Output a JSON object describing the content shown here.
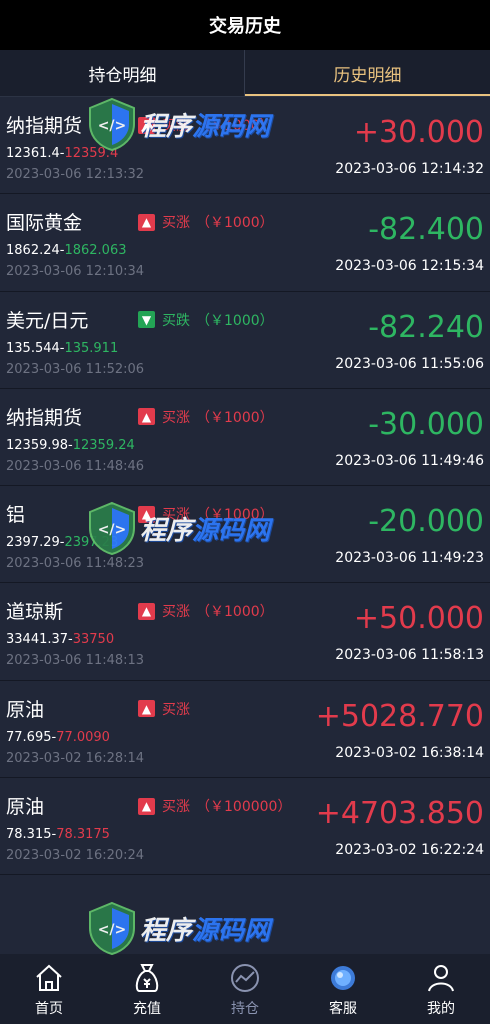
{
  "header": {
    "title": "交易历史"
  },
  "tabs": [
    {
      "label": "持仓明细",
      "active": false
    },
    {
      "label": "历史明细",
      "active": true
    }
  ],
  "colors": {
    "up": "#e23b4c",
    "down": "#2eb662",
    "accent": "#e9c27f",
    "background": "#212738"
  },
  "trades": [
    {
      "name": "纳指期货",
      "direction": "up",
      "label": "买涨",
      "amount": "（￥1000）",
      "open_price": "12361.4-",
      "close_price": "12359.4",
      "close_color": "red",
      "open_time": "2023-03-06 12:13:32",
      "pnl": "+30.000",
      "pnl_color": "red",
      "close_time": "2023-03-06 12:14:32"
    },
    {
      "name": "国际黄金",
      "direction": "up",
      "label": "买涨",
      "amount": "（￥1000）",
      "open_price": "1862.24-",
      "close_price": "1862.063",
      "close_color": "green",
      "open_time": "2023-03-06 12:10:34",
      "pnl": "-82.400",
      "pnl_color": "green",
      "close_time": "2023-03-06 12:15:34"
    },
    {
      "name": "美元/日元",
      "direction": "down",
      "label": "买跌",
      "amount": "（￥1000）",
      "open_price": "135.544-",
      "close_price": "135.911",
      "close_color": "green",
      "open_time": "2023-03-06 11:52:06",
      "pnl": "-82.240",
      "pnl_color": "green",
      "close_time": "2023-03-06 11:55:06"
    },
    {
      "name": "纳指期货",
      "direction": "up",
      "label": "买涨",
      "amount": "（￥1000）",
      "open_price": "12359.98-",
      "close_price": "12359.24",
      "close_color": "green",
      "open_time": "2023-03-06 11:48:46",
      "pnl": "-30.000",
      "pnl_color": "green",
      "close_time": "2023-03-06 11:49:46"
    },
    {
      "name": "铝",
      "direction": "up",
      "label": "买涨",
      "amount": "（￥1000）",
      "open_price": "2397.29-",
      "close_price": "2397.23",
      "close_color": "green",
      "open_time": "2023-03-06 11:48:23",
      "pnl": "-20.000",
      "pnl_color": "green",
      "close_time": "2023-03-06 11:49:23"
    },
    {
      "name": "道琼斯",
      "direction": "up",
      "label": "买涨",
      "amount": "（￥1000）",
      "open_price": "33441.37-",
      "close_price": "33750",
      "close_color": "red",
      "open_time": "2023-03-06 11:48:13",
      "pnl": "+50.000",
      "pnl_color": "red",
      "close_time": "2023-03-06 11:58:13"
    },
    {
      "name": "原油",
      "direction": "up",
      "label": "买涨",
      "amount": "",
      "open_price": "77.695-",
      "close_price": "77.0090",
      "close_color": "red",
      "open_time": "2023-03-02 16:28:14",
      "pnl": "+5028.770",
      "pnl_color": "red",
      "close_time": "2023-03-02 16:38:14"
    },
    {
      "name": "原油",
      "direction": "up",
      "label": "买涨",
      "amount": "（￥100000）",
      "open_price": "78.315-",
      "close_price": "78.3175",
      "close_color": "red",
      "open_time": "2023-03-02 16:20:24",
      "pnl": "+4703.850",
      "pnl_color": "red",
      "close_time": "2023-03-02 16:22:24"
    }
  ],
  "watermark": {
    "text_white": "程序",
    "text_blue": "源码网"
  },
  "nav": [
    {
      "label": "首页",
      "icon": "home-icon",
      "active": false
    },
    {
      "label": "充值",
      "icon": "money-bag-icon",
      "active": false
    },
    {
      "label": "持仓",
      "icon": "chart-icon",
      "active": true
    },
    {
      "label": "客服",
      "icon": "support-icon",
      "active": false
    },
    {
      "label": "我的",
      "icon": "user-icon",
      "active": false
    }
  ]
}
